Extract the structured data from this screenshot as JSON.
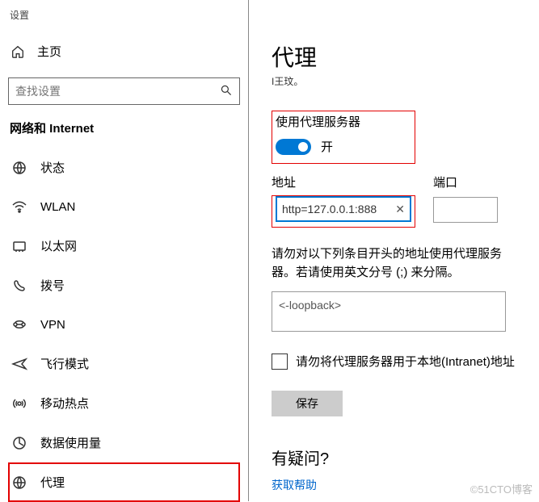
{
  "settings_label": "设置",
  "home_label": "主页",
  "search": {
    "placeholder": "查找设置"
  },
  "section_header": "网络和 Internet",
  "nav": [
    {
      "label": "状态",
      "icon": "status"
    },
    {
      "label": "WLAN",
      "icon": "wifi"
    },
    {
      "label": "以太网",
      "icon": "ethernet"
    },
    {
      "label": "拨号",
      "icon": "dialup"
    },
    {
      "label": "VPN",
      "icon": "vpn"
    },
    {
      "label": "飞行模式",
      "icon": "airplane"
    },
    {
      "label": "移动热点",
      "icon": "hotspot"
    },
    {
      "label": "数据使用量",
      "icon": "datausage"
    },
    {
      "label": "代理",
      "icon": "proxy"
    }
  ],
  "page_title": "代理",
  "page_subtitle": "I王玟。",
  "proxy_section": {
    "title": "使用代理服务器",
    "toggle_state": "开"
  },
  "address": {
    "label": "地址",
    "value": "http=127.0.0.1:888"
  },
  "port": {
    "label": "端口"
  },
  "bypass_note": "请勿对以下列条目开头的地址使用代理服务器。若请使用英文分号 (;) 来分隔。",
  "bypass_value": "<-loopback>",
  "intranet_checkbox": "请勿将代理服务器用于本地(Intranet)地址",
  "save_label": "保存",
  "help": {
    "title": "有疑问?",
    "link": "获取帮助"
  },
  "watermark": "©51CTO博客"
}
